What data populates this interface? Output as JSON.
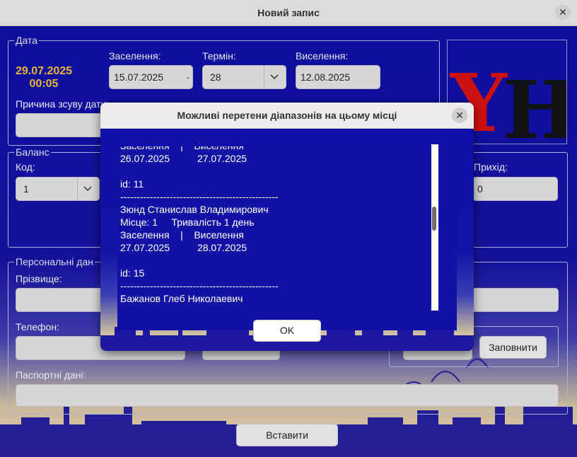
{
  "window": {
    "title": "Новий запис",
    "close_icon": "✕"
  },
  "date_group": {
    "legend": "Дата",
    "current_date": "29.07.2025",
    "current_time": "00:05",
    "checkin_label": "Заселення:",
    "checkin_value": "15.07.2025",
    "checkin_spin": "-",
    "term_label": "Термін:",
    "term_value": "28",
    "checkout_label": "Виселення:",
    "checkout_value": "12.08.2025",
    "shift_reason_label": "Причина зсуву дати:",
    "shift_reason_value": ""
  },
  "logo": {
    "letters": "YH",
    "colors": {
      "Y": "#cc1111",
      "H": "#111111"
    }
  },
  "balance_group": {
    "legend": "Баланс",
    "code_label": "Код:",
    "code_value": "1",
    "income_label": "Прихід:",
    "income_value": "0"
  },
  "personal_group": {
    "legend": "Персональні дан",
    "surname_label": "Прізвище:",
    "phone_label": "Телефон:",
    "passport_label": "Паспортні дані:",
    "fill_button": "Заповнити"
  },
  "insert_button": "Вставити",
  "dialog": {
    "title": "Можливі перетени діапазонів на цьому місці",
    "close_icon": "✕",
    "lines": [
      "Заселення    |    Виселення",
      "26.07.2025          27.07.2025",
      "",
      "id: 11",
      "------------------------------------------------",
      "Зюнд Станислав Владимирович",
      "Місце: 1     Тривалість 1 день",
      "Заселення    |    Виселення",
      "27.07.2025          28.07.2025",
      "",
      "id: 15",
      "------------------------------------------------",
      "Бажанов Глеб Николаевич"
    ],
    "ok_button": "OK"
  },
  "colors": {
    "accent_date": "#e8b43a",
    "background": "#15129a"
  }
}
